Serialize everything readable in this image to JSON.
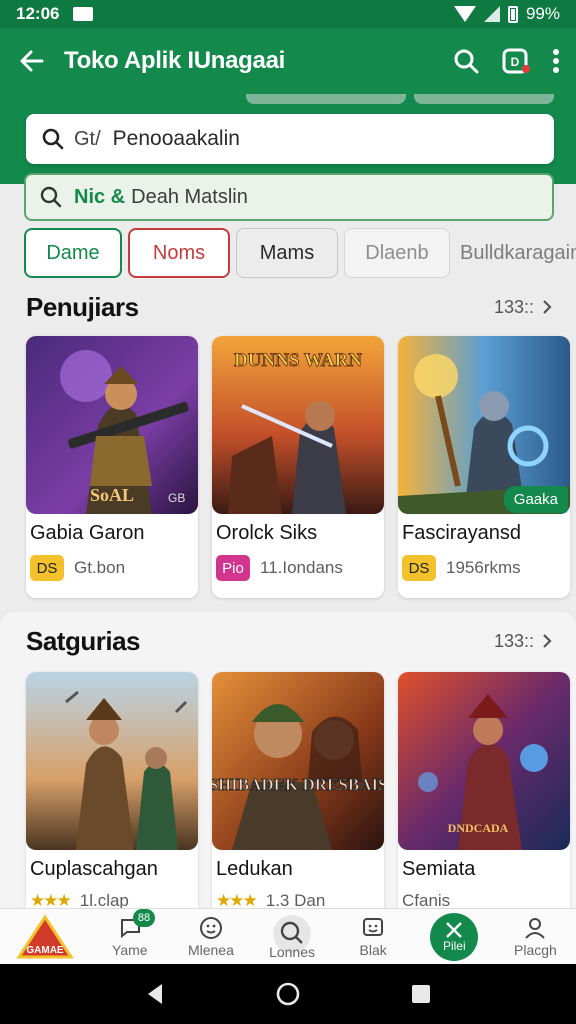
{
  "status_bar": {
    "time": "12:06",
    "battery": "99%"
  },
  "app_bar": {
    "title": "Toko Aplik IUnagaai"
  },
  "search": {
    "placeholder": "Penooaakalin",
    "prefix": "Gt/"
  },
  "sub_search": {
    "accent": "Nic &",
    "text": "Deah Matslin"
  },
  "chips": [
    "Dame",
    "Noms",
    "Mams",
    "Dlaenb",
    "Bulldkaragain"
  ],
  "section1": {
    "title": "Penujiars",
    "more": "133::",
    "cards": [
      {
        "name": "Gabia Garon",
        "badge": "DS",
        "badge_color": "#f3c12c",
        "meta": "Gt.bon",
        "art_text": "SoAL",
        "art_corner": "GB"
      },
      {
        "name": "Orolck Siks",
        "badge": "Pio",
        "badge_color": "#d2348e",
        "meta": "11.Iondans",
        "art_text": "DUNNS WARN"
      },
      {
        "name": "Fascirayansd",
        "badge": "DS",
        "badge_color": "#f3c12c",
        "meta": "1956rkms",
        "tag": "Gaaka"
      }
    ]
  },
  "section2": {
    "title": "Satgurias",
    "more": "133::",
    "cards": [
      {
        "name": "Cuplascahgan",
        "stars": "★★★",
        "meta": "1l.clap"
      },
      {
        "name": "Ledukan",
        "stars": "★★★",
        "meta": "1.3 Dan",
        "art_text": "SHIBADEK DRESBAIS"
      },
      {
        "name": "Semiata",
        "meta": "Cfanis",
        "art_text": "DNDCADA"
      }
    ]
  },
  "bottom_nav": {
    "items": [
      {
        "label": "",
        "icon": "store-logo-icon",
        "logo_text": "GAMAE"
      },
      {
        "label": "Yame",
        "icon": "chat-icon",
        "badge": "88"
      },
      {
        "label": "Mlenea",
        "icon": "face-icon"
      },
      {
        "label": "Lonnes",
        "icon": "search-icon"
      },
      {
        "label": "Blak",
        "icon": "smile-box-icon"
      },
      {
        "label": "Pilei",
        "icon": "swords-icon"
      },
      {
        "label": "Placgh",
        "icon": "person-icon"
      }
    ]
  },
  "colors": {
    "primary": "#138a4c",
    "accent_red": "#c43c3c",
    "badge_yellow": "#f3c12c",
    "badge_magenta": "#d2348e"
  }
}
